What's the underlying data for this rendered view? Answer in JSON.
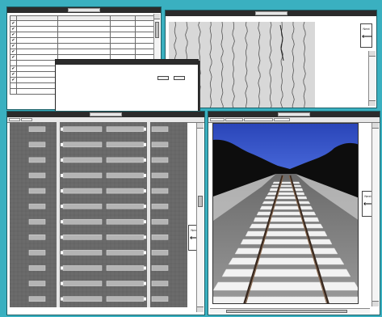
{
  "colors": {
    "desktop": "#3ab0c0",
    "titlebar": "#2b2b2b",
    "track_gray": "#6b6b6b",
    "sky": "#2f4fbf"
  },
  "windows": {
    "data_table": {
      "title": "",
      "columns": [
        "",
        "",
        "",
        "",
        ""
      ],
      "rows": [
        {
          "checked": "✔",
          "c1": "",
          "c2": "",
          "c3": "",
          "c4": ""
        },
        {
          "checked": "✔",
          "c1": "",
          "c2": "",
          "c3": "",
          "c4": ""
        },
        {
          "checked": "✔",
          "c1": "",
          "c2": "",
          "c3": "",
          "c4": ""
        },
        {
          "checked": "✔",
          "c1": "",
          "c2": "",
          "c3": "",
          "c4": ""
        },
        {
          "checked": "✔",
          "c1": "",
          "c2": "",
          "c3": "",
          "c4": ""
        },
        {
          "checked": "✔",
          "c1": "",
          "c2": "",
          "c3": "",
          "c4": ""
        },
        {
          "checked": "✔",
          "c1": "",
          "c2": "",
          "c3": "",
          "c4": ""
        },
        {
          "checked": "",
          "c1": "",
          "c2": "",
          "c3": "",
          "c4": ""
        },
        {
          "checked": "✔",
          "c1": "",
          "c2": "",
          "c3": "",
          "c4": ""
        },
        {
          "checked": "✔",
          "c1": "",
          "c2": "",
          "c3": "",
          "c4": ""
        },
        {
          "checked": "✔",
          "c1": "",
          "c2": "",
          "c3": "",
          "c4": ""
        },
        {
          "checked": "",
          "c1": "",
          "c2": "",
          "c3": "",
          "c4": ""
        },
        {
          "checked": "",
          "c1": "",
          "c2": "",
          "c3": "",
          "c4": ""
        }
      ]
    },
    "dialog": {
      "field_a": "",
      "field_b": "",
      "field_c": "",
      "field_d": "",
      "field_e": "",
      "field_f": ""
    },
    "signal_view": {
      "title": "",
      "next_label": "Next"
    },
    "tie_view": {
      "title": "",
      "toolbar": [
        "",
        ""
      ],
      "next_label": "Next",
      "tie_count": 12
    },
    "photo_view": {
      "title": "",
      "toolbar": [
        "",
        "",
        "",
        ""
      ],
      "next_label": "Next"
    }
  }
}
